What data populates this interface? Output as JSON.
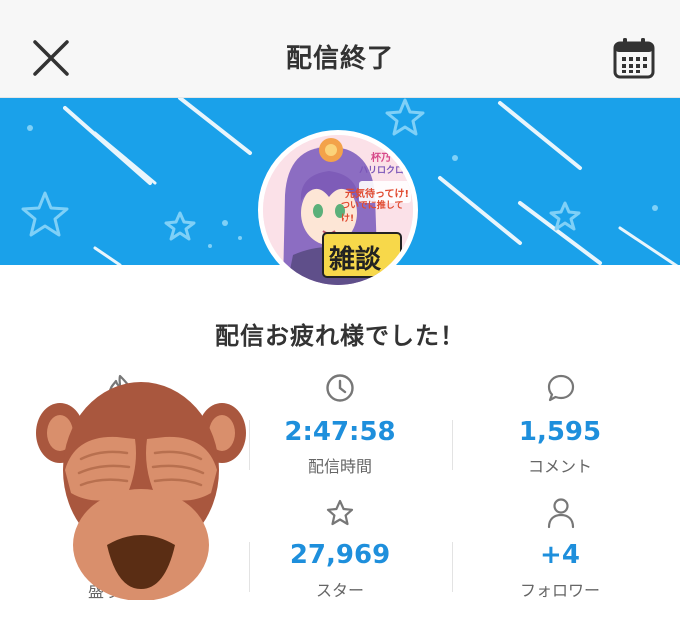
{
  "header": {
    "title": "配信終了",
    "close_icon": "close-icon",
    "calendar_icon": "calendar-icon"
  },
  "banner": {
    "background_color": "#1aa1ea"
  },
  "thumbnail_text": {
    "line1": "杯乃",
    "line2": "ハリロクロ",
    "line3": "元気待ってけ!",
    "line4": "ついでに推してけ!",
    "badge": "雑談"
  },
  "message": "配信お疲れ様でした！",
  "stats": [
    {
      "icon": "flame-icon",
      "value": "",
      "label": "盛り上がり"
    },
    {
      "icon": "clock-icon",
      "value": "2:47:58",
      "label": "配信時間"
    },
    {
      "icon": "comment-icon",
      "value": "1,595",
      "label": "コメント"
    },
    {
      "icon": "star-icon",
      "value": "27,969",
      "label": "スター"
    },
    {
      "icon": "person-icon",
      "value": "+4",
      "label": "フォロワー"
    }
  ],
  "overlay": {
    "icon": "see-no-evil-monkey-icon"
  },
  "colors": {
    "accent": "#1e8fdc",
    "text": "#333333",
    "muted": "#666666"
  }
}
